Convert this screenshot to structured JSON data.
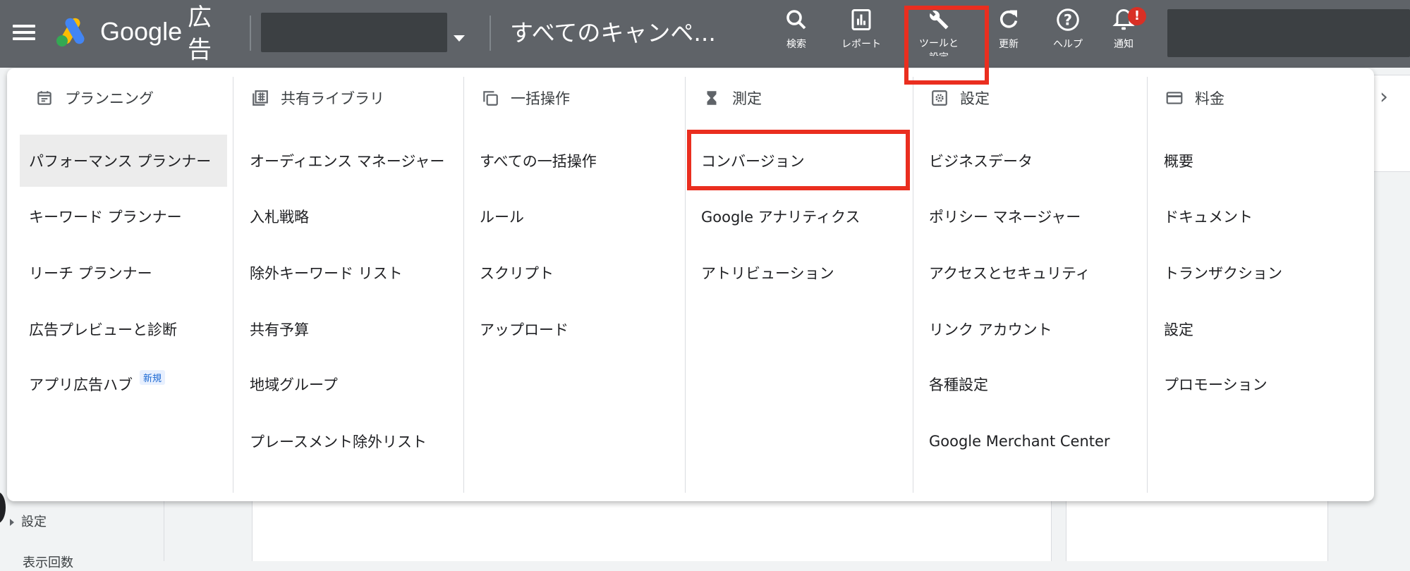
{
  "header": {
    "brand": "Google",
    "product": "広告",
    "campaign_title": "すべてのキャンペ...",
    "buttons": [
      {
        "label": "検索",
        "icon": "search-icon"
      },
      {
        "label": "レポート",
        "icon": "bar-chart-icon"
      },
      {
        "label": "ツールと設定",
        "icon": "wrench-icon"
      },
      {
        "label": "更新",
        "icon": "refresh-icon"
      },
      {
        "label": "ヘルプ",
        "icon": "help-icon"
      },
      {
        "label": "通知",
        "icon": "bell-icon"
      }
    ],
    "notification_badge": "!"
  },
  "menu": {
    "columns": [
      {
        "title": "プランニング",
        "icon": "calendar-icon",
        "items": [
          "パフォーマンス プランナー",
          "キーワード プランナー",
          "リーチ プランナー",
          "広告プレビューと診断",
          "アプリ広告ハブ"
        ],
        "new_badge": "新規"
      },
      {
        "title": "共有ライブラリ",
        "icon": "library-grid-icon",
        "items": [
          "オーディエンス マネージャー",
          "入札戦略",
          "除外キーワード リスト",
          "共有予算",
          "地域グループ",
          "プレースメント除外リスト"
        ]
      },
      {
        "title": "一括操作",
        "icon": "copy-icon",
        "items": [
          "すべての一括操作",
          "ルール",
          "スクリプト",
          "アップロード"
        ]
      },
      {
        "title": "測定",
        "icon": "hourglass-icon",
        "items": [
          "コンバージョン",
          "Google アナリティクス",
          "アトリビューション"
        ]
      },
      {
        "title": "設定",
        "icon": "settings-gear-icon",
        "items": [
          "ビジネスデータ",
          "ポリシー マネージャー",
          "アクセスとセキュリティ",
          "リンク アカウント",
          "各種設定",
          "Google Merchant Center"
        ]
      },
      {
        "title": "料金",
        "icon": "credit-card-icon",
        "items": [
          "概要",
          "ドキュメント",
          "トランザクション",
          "設定",
          "プロモーション"
        ]
      }
    ]
  },
  "background": {
    "sidebar_setting": "設定",
    "sidebar_cut": "表示回数"
  },
  "colors": {
    "topbar": "#5f6368",
    "highlight": "#ea2e1f",
    "active_row": "#ececec",
    "badge": "#d93025"
  }
}
